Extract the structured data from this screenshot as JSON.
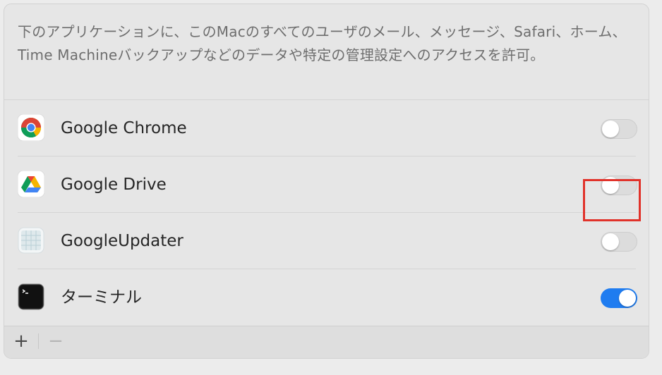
{
  "description": "下のアプリケーションに、このMacのすべてのユーザのメール、メッセージ、Safari、ホーム、Time Machineバックアップなどのデータや特定の管理設定へのアクセスを許可。",
  "apps": [
    {
      "name": "Google Chrome",
      "icon": "chrome-icon",
      "enabled": false
    },
    {
      "name": "Google Drive",
      "icon": "google-drive-icon",
      "enabled": false
    },
    {
      "name": "GoogleUpdater",
      "icon": "google-updater-icon",
      "enabled": false
    },
    {
      "name": "ターミナル",
      "icon": "terminal-icon",
      "enabled": true
    }
  ],
  "toolbar": {
    "add_label": "+",
    "remove_label": "−"
  },
  "colors": {
    "toggle_on": "#1f7cf0",
    "highlight": "#e1322a"
  }
}
